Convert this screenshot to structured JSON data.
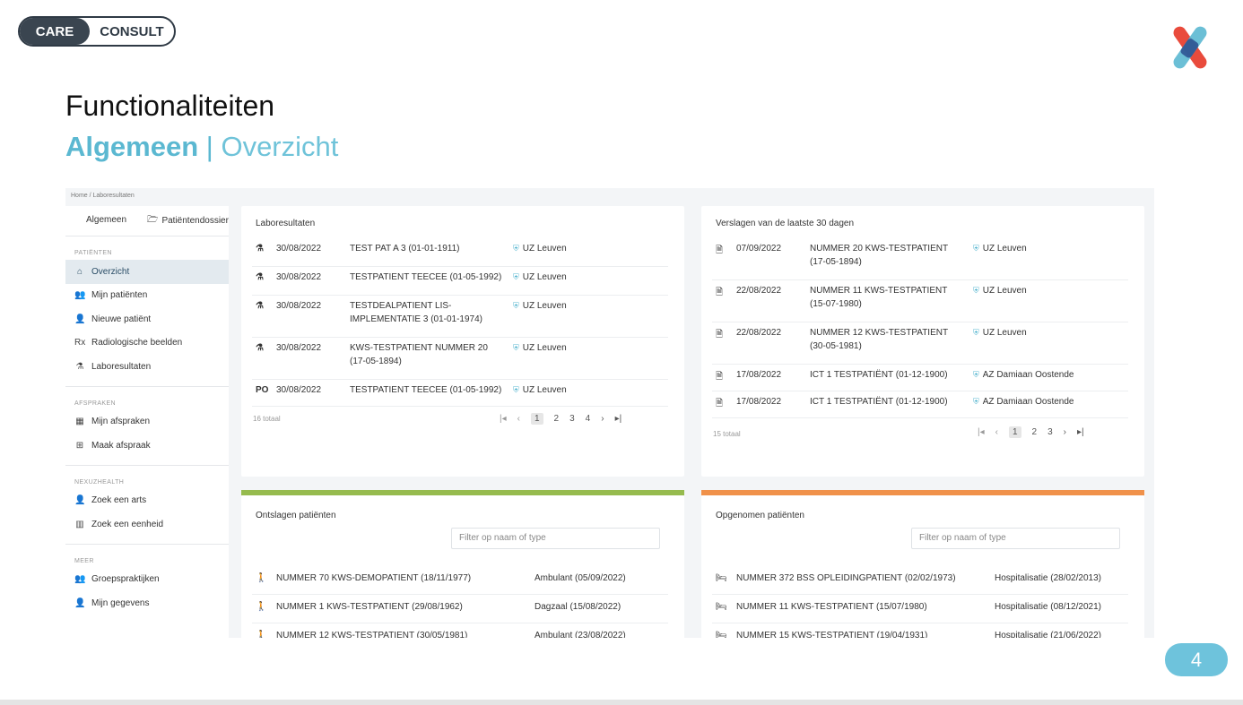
{
  "logo": {
    "care": "CARE",
    "consult": "CONSULT"
  },
  "slide": {
    "title": "Functionaliteiten",
    "subtitle_strong": "Algemeen",
    "subtitle_sep": " | ",
    "subtitle_light": "Overzicht",
    "page_number": "4"
  },
  "colors": {
    "accent": "#5bb8d1",
    "green_bar": "#96bb4e",
    "orange_bar": "#f0914a",
    "active_item": "#e3eaef"
  },
  "app": {
    "breadcrumb": "Home / Laboresultaten",
    "tabs": [
      {
        "label": "Algemeen"
      },
      {
        "label": "Patiëntendossier",
        "icon": "folder-icon"
      }
    ],
    "sections": [
      {
        "title": "PATIËNTEN",
        "items": [
          {
            "label": "Overzicht",
            "icon": "home-icon",
            "glyph": "⌂",
            "active": true
          },
          {
            "label": "Mijn patiënten",
            "icon": "users-icon",
            "glyph": "👥"
          },
          {
            "label": "Nieuwe patiënt",
            "icon": "add-user-icon",
            "glyph": "👤"
          },
          {
            "label": "Radiologische beelden",
            "icon": "rx-icon",
            "glyph": "Rx"
          },
          {
            "label": "Laboresultaten",
            "icon": "flask-icon",
            "glyph": "⚗"
          }
        ]
      },
      {
        "title": "AFSPRAKEN",
        "items": [
          {
            "label": "Mijn afspraken",
            "icon": "calendar-icon",
            "glyph": "▦"
          },
          {
            "label": "Maak afspraak",
            "icon": "calendar-plus-icon",
            "glyph": "⊞"
          }
        ]
      },
      {
        "title": "NEXUZHEALTH",
        "items": [
          {
            "label": "Zoek een arts",
            "icon": "doctor-icon",
            "glyph": "👤"
          },
          {
            "label": "Zoek een eenheid",
            "icon": "building-icon",
            "glyph": "▥"
          }
        ]
      },
      {
        "title": "MEER",
        "items": [
          {
            "label": "Groepspraktijken",
            "icon": "group-icon",
            "glyph": "👥"
          },
          {
            "label": "Mijn gegevens",
            "icon": "user-icon",
            "glyph": "👤"
          }
        ]
      }
    ],
    "lab": {
      "title": "Laboresultaten",
      "rows": [
        {
          "icon": "flask-icon",
          "glyph": "⚗",
          "date": "30/08/2022",
          "patient": "TEST PAT A 3 (01-01-1911)",
          "location": "UZ Leuven"
        },
        {
          "icon": "flask-icon",
          "glyph": "⚗",
          "date": "30/08/2022",
          "patient": "TESTPATIENT TEECEE (01-05-1992)",
          "location": "UZ Leuven"
        },
        {
          "icon": "flask-icon",
          "glyph": "⚗",
          "date": "30/08/2022",
          "patient": "TESTDEALPATIENT LIS-IMPLEMENTATIE 3 (01-01-1974)",
          "location": "UZ Leuven"
        },
        {
          "icon": "flask-icon",
          "glyph": "⚗",
          "date": "30/08/2022",
          "patient": "KWS-TESTPATIENT NUMMER 20 (17-05-1894)",
          "location": "UZ Leuven"
        },
        {
          "icon": "po-icon",
          "glyph": "PO",
          "date": "30/08/2022",
          "patient": "TESTPATIENT TEECEE (01-05-1992)",
          "location": "UZ Leuven"
        }
      ],
      "total": "16 totaal",
      "pages": [
        "1",
        "2",
        "3",
        "4"
      ]
    },
    "reports": {
      "title": "Verslagen van de laatste 30 dagen",
      "rows": [
        {
          "date": "07/09/2022",
          "patient": "NUMMER 20 KWS-TESTPATIENT (17-05-1894)",
          "location": "UZ Leuven"
        },
        {
          "date": "22/08/2022",
          "patient": "NUMMER 11 KWS-TESTPATIENT (15-07-1980)",
          "location": "UZ Leuven"
        },
        {
          "date": "22/08/2022",
          "patient": "NUMMER 12 KWS-TESTPATIENT (30-05-1981)",
          "location": "UZ Leuven"
        },
        {
          "date": "17/08/2022",
          "patient": "ICT 1 TESTPATIËNT (01-12-1900)",
          "location": "AZ Damiaan Oostende"
        },
        {
          "date": "17/08/2022",
          "patient": "ICT 1 TESTPATIËNT (01-12-1900)",
          "location": "AZ Damiaan Oostende"
        }
      ],
      "total": "15 totaal",
      "pages": [
        "1",
        "2",
        "3"
      ]
    },
    "discharged": {
      "title": "Ontslagen patiënten",
      "filter_placeholder": "Filter op naam of type",
      "rows": [
        {
          "patient": "NUMMER 70 KWS-DEMOPATIENT (18/11/1977)",
          "status": "Ambulant (05/09/2022)"
        },
        {
          "patient": "NUMMER 1 KWS-TESTPATIENT (29/08/1962)",
          "status": "Dagzaal (15/08/2022)"
        },
        {
          "patient": "NUMMER 12 KWS-TESTPATIENT (30/05/1981)",
          "status": "Ambulant (23/08/2022)"
        }
      ]
    },
    "admitted": {
      "title": "Opgenomen patiënten",
      "filter_placeholder": "Filter op naam of type",
      "rows": [
        {
          "patient": "NUMMER 372 BSS OPLEIDINGPATIENT (02/02/1973)",
          "status": "Hospitalisatie (28/02/2013)"
        },
        {
          "patient": "NUMMER 11 KWS-TESTPATIENT (15/07/1980)",
          "status": "Hospitalisatie (08/12/2021)"
        },
        {
          "patient": "NUMMER 15 KWS-TESTPATIENT (19/04/1931)",
          "status": "Hospitalisatie (21/06/2022)"
        }
      ]
    }
  }
}
